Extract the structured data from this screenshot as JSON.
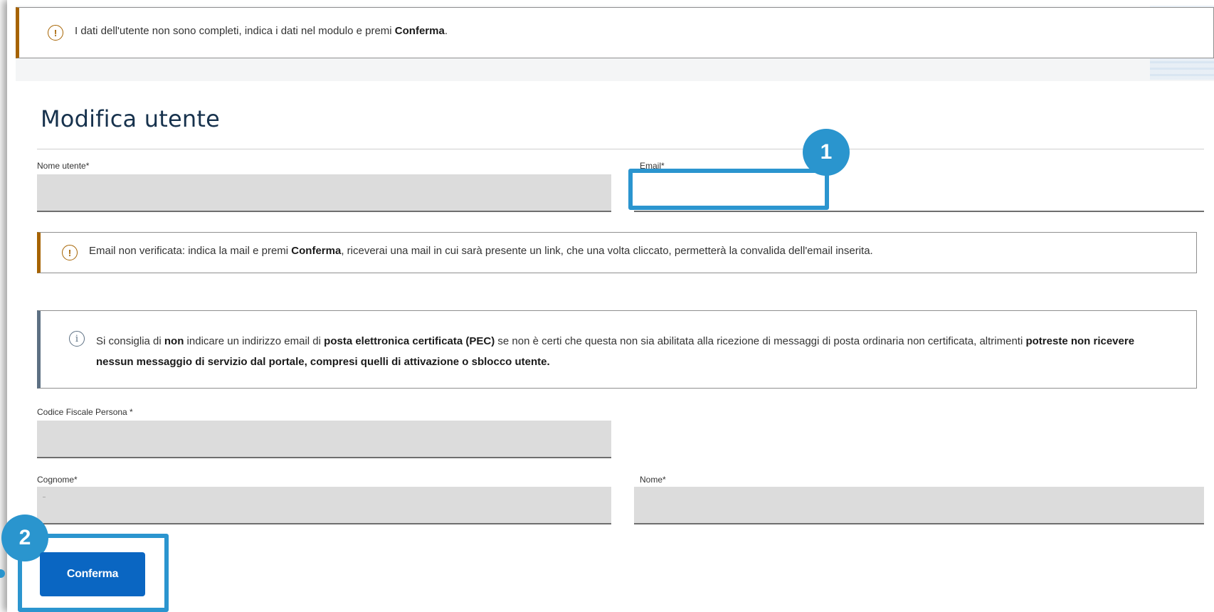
{
  "alerts": {
    "top": {
      "text_before": "I dati dell'utente non sono completi, indica i dati nel modulo e premi ",
      "bold": "Conferma",
      "text_after": "."
    },
    "email_warning": {
      "text_before": "Email non verificata: indica la mail e premi ",
      "bold": "Conferma",
      "text_after": ", riceverai una mail in cui sarà presente un link, che una volta cliccato, permetterà la convalida dell'email inserita."
    },
    "pec_info": {
      "t1": "Si consiglia di ",
      "b1": "non",
      "t2": " indicare un indirizzo email di ",
      "b2": "posta elettronica certificata (PEC)",
      "t3": " se non è certi che questa non sia abilitata alla ricezione di messaggi di posta ordinaria non certificata, altrimenti ",
      "b3": "potreste non ricevere nessun messaggio di servizio dal portale, compresi quelli di attivazione o sblocco utente."
    },
    "warn_icon": "exclamation-circle-icon",
    "info_icon": "info-circle-icon"
  },
  "form": {
    "title": "Modifica utente",
    "fields": {
      "nome_utente": {
        "label": "Nome utente*",
        "value": ""
      },
      "email": {
        "label": "Email*",
        "value": ""
      },
      "codice_fiscale": {
        "label": "Codice Fiscale Persona *",
        "value": ""
      },
      "cognome": {
        "label": "Cognome*",
        "value": ""
      },
      "nome": {
        "label": "Nome*",
        "value": ""
      }
    },
    "submit_label": "Conferma"
  },
  "callouts": {
    "one": "1",
    "two": "2"
  },
  "colors": {
    "accent": "#2a95ce",
    "primary_button": "#0a66c2",
    "warning_border": "#a66300",
    "info_border": "#5d7083",
    "title": "#17324d"
  }
}
